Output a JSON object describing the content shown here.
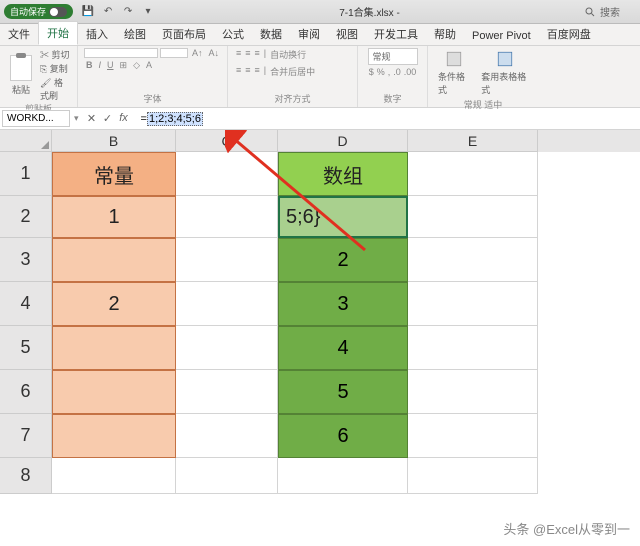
{
  "title_bar": {
    "autosave": "自动保存",
    "doc": "7-1合集.xlsx  -",
    "search": "搜索"
  },
  "tabs": [
    "文件",
    "开始",
    "插入",
    "绘图",
    "页面布局",
    "公式",
    "数据",
    "审阅",
    "视图",
    "开发工具",
    "帮助",
    "Power Pivot",
    "百度网盘"
  ],
  "active_tab": 1,
  "ribbon": {
    "clipboard": {
      "paste": "粘贴",
      "cut": "剪切",
      "copy": "复制",
      "format": "格式刷",
      "label": "剪贴板"
    },
    "font": {
      "label": "字体",
      "bold": "B",
      "italic": "I",
      "underline": "U"
    },
    "align": {
      "label": "对齐方式",
      "wrap": "自动换行",
      "merge": "合并后居中"
    },
    "number": {
      "label": "数字",
      "format": "常规"
    },
    "styles": {
      "cond": "条件格式",
      "table": "套用表格格式",
      "cell": "常规",
      "label": "适中"
    }
  },
  "name_box": "WORKD...",
  "formula": "={1;2;3;4;5;6}",
  "formula_sel": "1;2;3;4;5;6",
  "columns": [
    "B",
    "C",
    "D",
    "E"
  ],
  "rows": [
    "1",
    "2",
    "3",
    "4",
    "5",
    "6",
    "7",
    "8"
  ],
  "cells": {
    "B1": "常量",
    "B2": "1",
    "B4": "2",
    "D1": "数组",
    "D2": "5;6}",
    "D3": "2",
    "D4": "3",
    "D5": "4",
    "D6": "5",
    "D7": "6"
  },
  "watermark": "头条 @Excel从零到一"
}
